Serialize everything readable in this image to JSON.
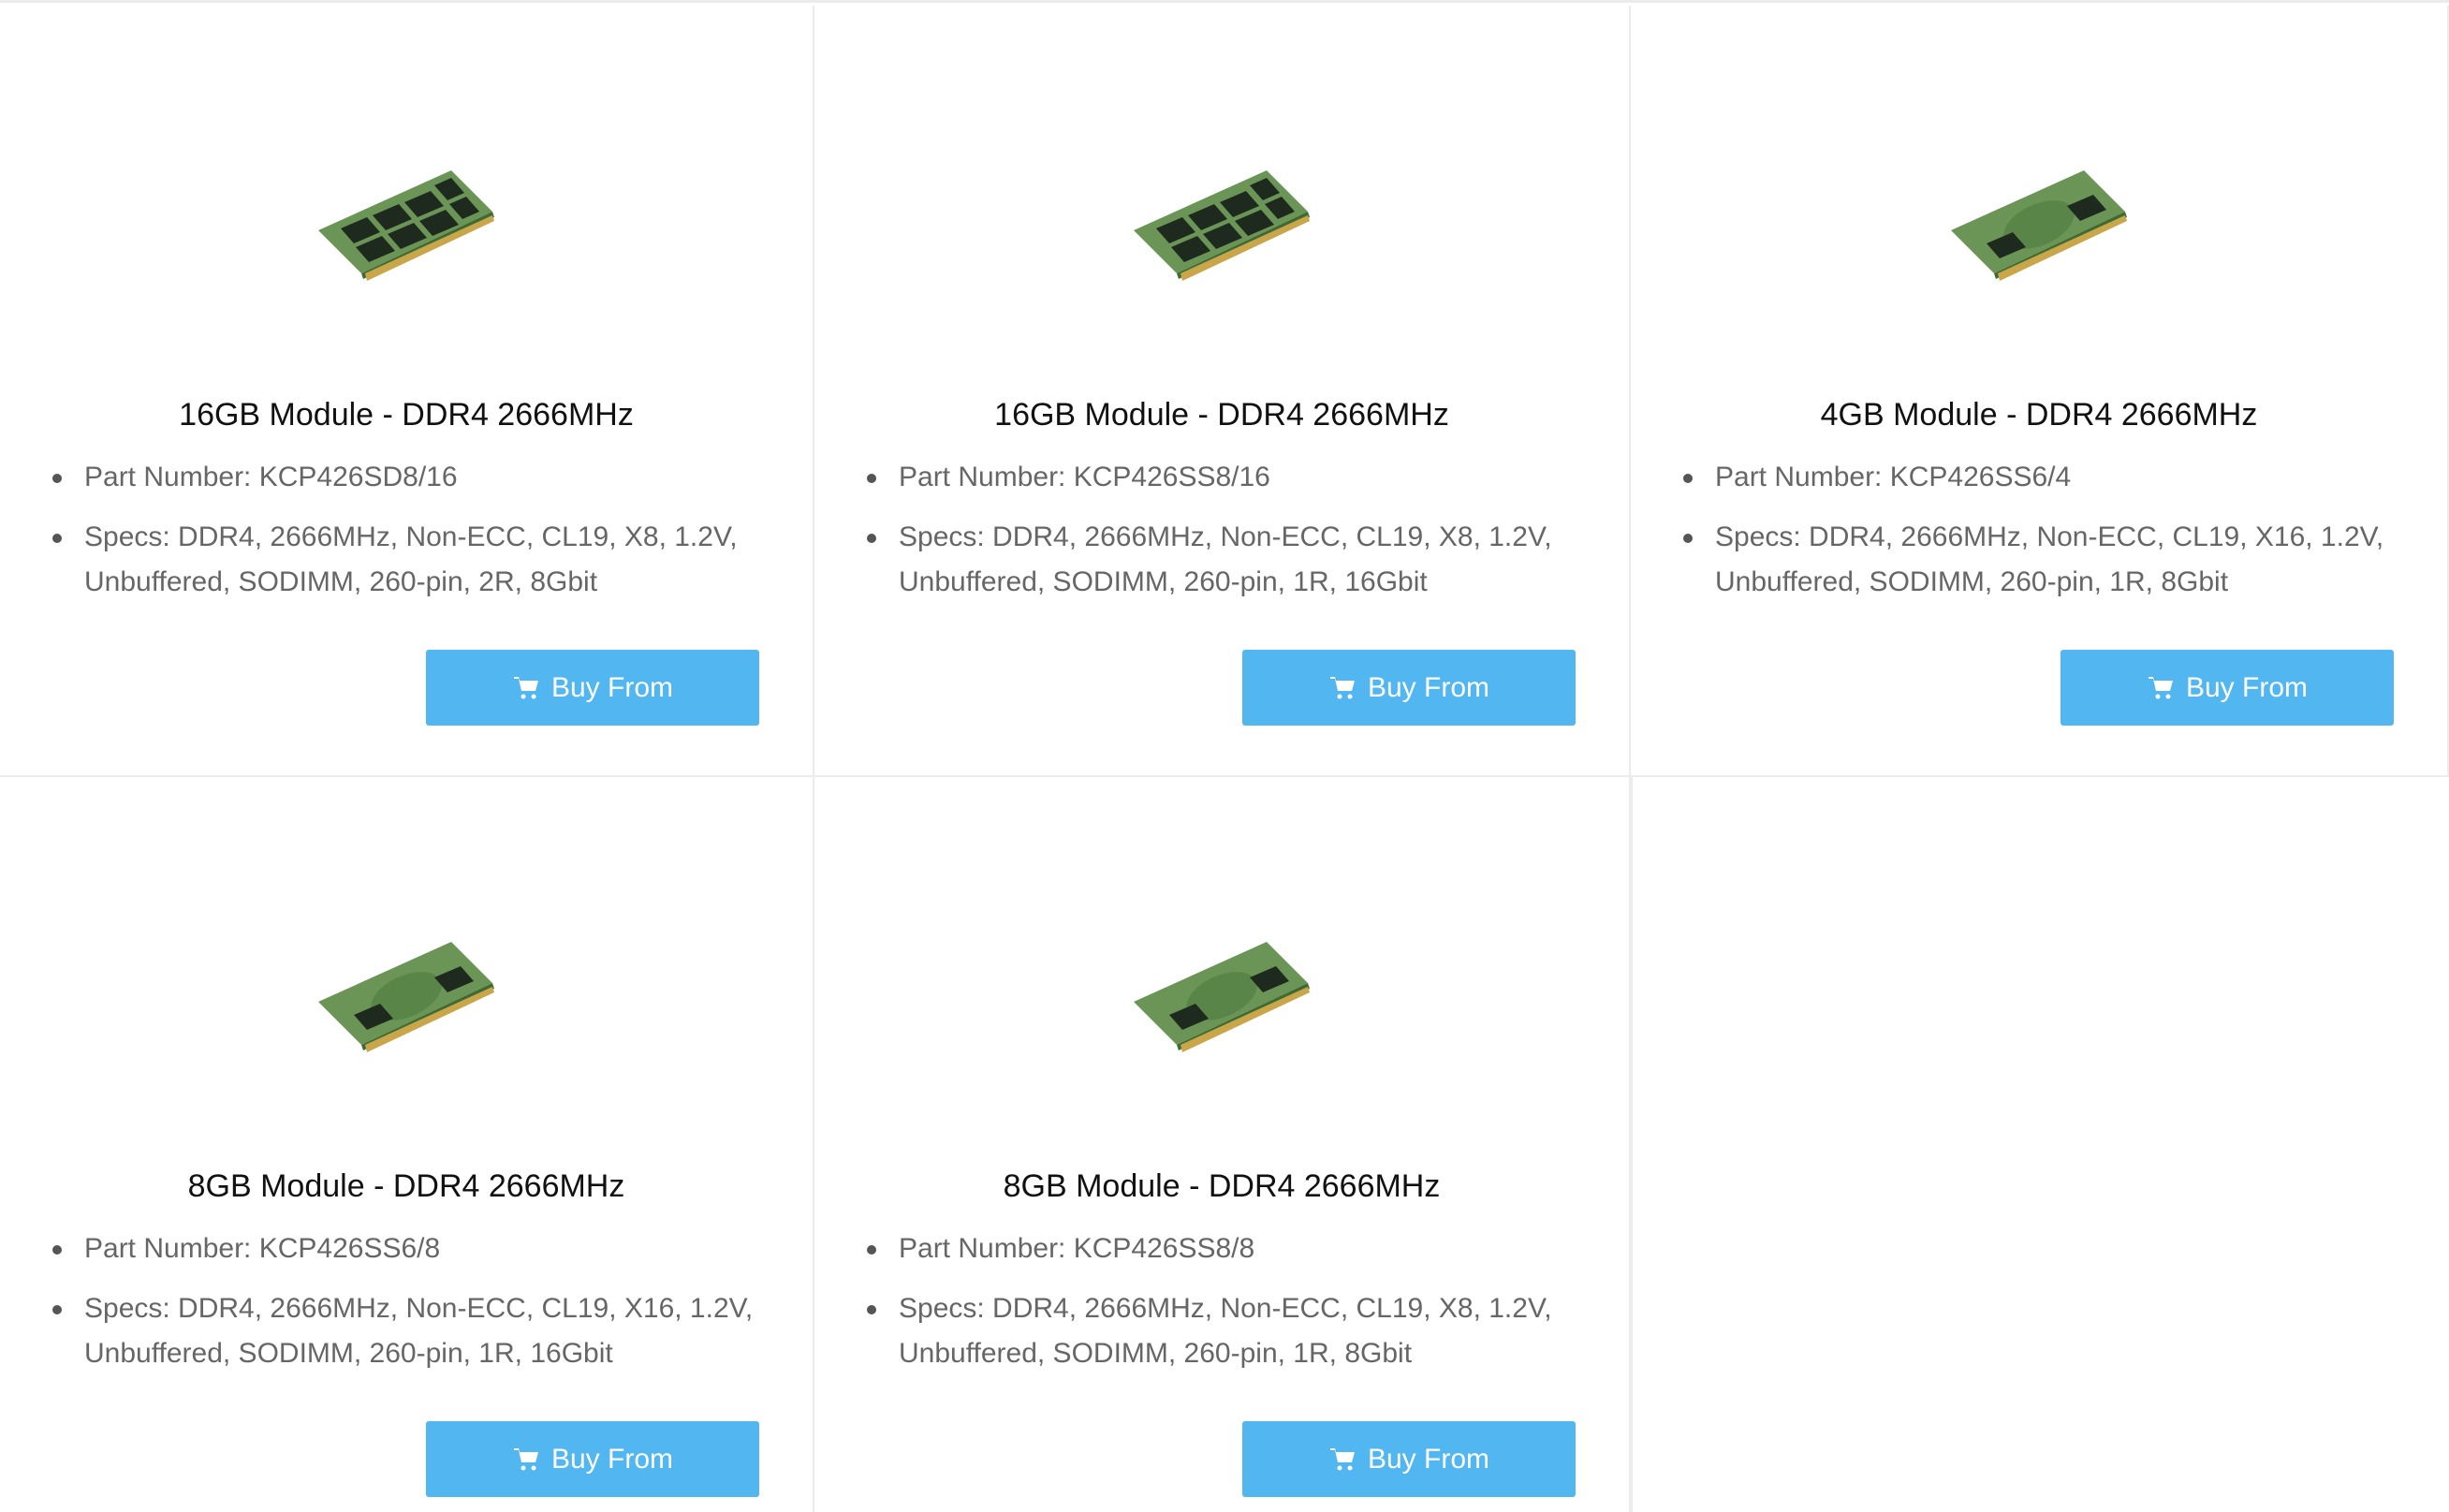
{
  "products": [
    {
      "title": "16GB Module - DDR4 2666MHz",
      "part_number": "Part Number: KCP426SD8/16",
      "specs": "Specs: DDR4, 2666MHz, Non-ECC, CL19, X8, 1.2V, Unbuffered, SODIMM, 260-pin, 2R, 8Gbit",
      "button_label": "Buy From",
      "image_icon": "ram-module-dual-rank-icon"
    },
    {
      "title": "16GB Module - DDR4 2666MHz",
      "part_number": "Part Number: KCP426SS8/16",
      "specs": "Specs: DDR4, 2666MHz, Non-ECC, CL19, X8, 1.2V, Unbuffered, SODIMM, 260-pin, 1R, 16Gbit",
      "button_label": "Buy From",
      "image_icon": "ram-module-dual-rank-icon"
    },
    {
      "title": "4GB Module - DDR4 2666MHz",
      "part_number": "Part Number: KCP426SS6/4",
      "specs": "Specs: DDR4, 2666MHz, Non-ECC, CL19, X16, 1.2V, Unbuffered, SODIMM, 260-pin, 1R, 8Gbit",
      "button_label": "Buy From",
      "image_icon": "ram-module-single-rank-icon"
    },
    {
      "title": "8GB Module - DDR4 2666MHz",
      "part_number": "Part Number: KCP426SS6/8",
      "specs": "Specs: DDR4, 2666MHz, Non-ECC, CL19, X16, 1.2V, Unbuffered, SODIMM, 260-pin, 1R, 16Gbit",
      "button_label": "Buy From",
      "image_icon": "ram-module-single-rank-icon"
    },
    {
      "title": "8GB Module - DDR4 2666MHz",
      "part_number": "Part Number: KCP426SS8/8",
      "specs": "Specs: DDR4, 2666MHz, Non-ECC, CL19, X8, 1.2V, Unbuffered, SODIMM, 260-pin, 1R, 8Gbit",
      "button_label": "Buy From",
      "image_icon": "ram-module-single-rank-icon"
    }
  ],
  "colors": {
    "button_background": "#52b6f1",
    "button_text": "#ffffff",
    "title_text": "#111111",
    "spec_text": "#666666",
    "border": "#ececec",
    "pcb_green": "#5d8a4a",
    "chip_black": "#1f2a1f",
    "gold_contacts": "#c9a64a"
  }
}
